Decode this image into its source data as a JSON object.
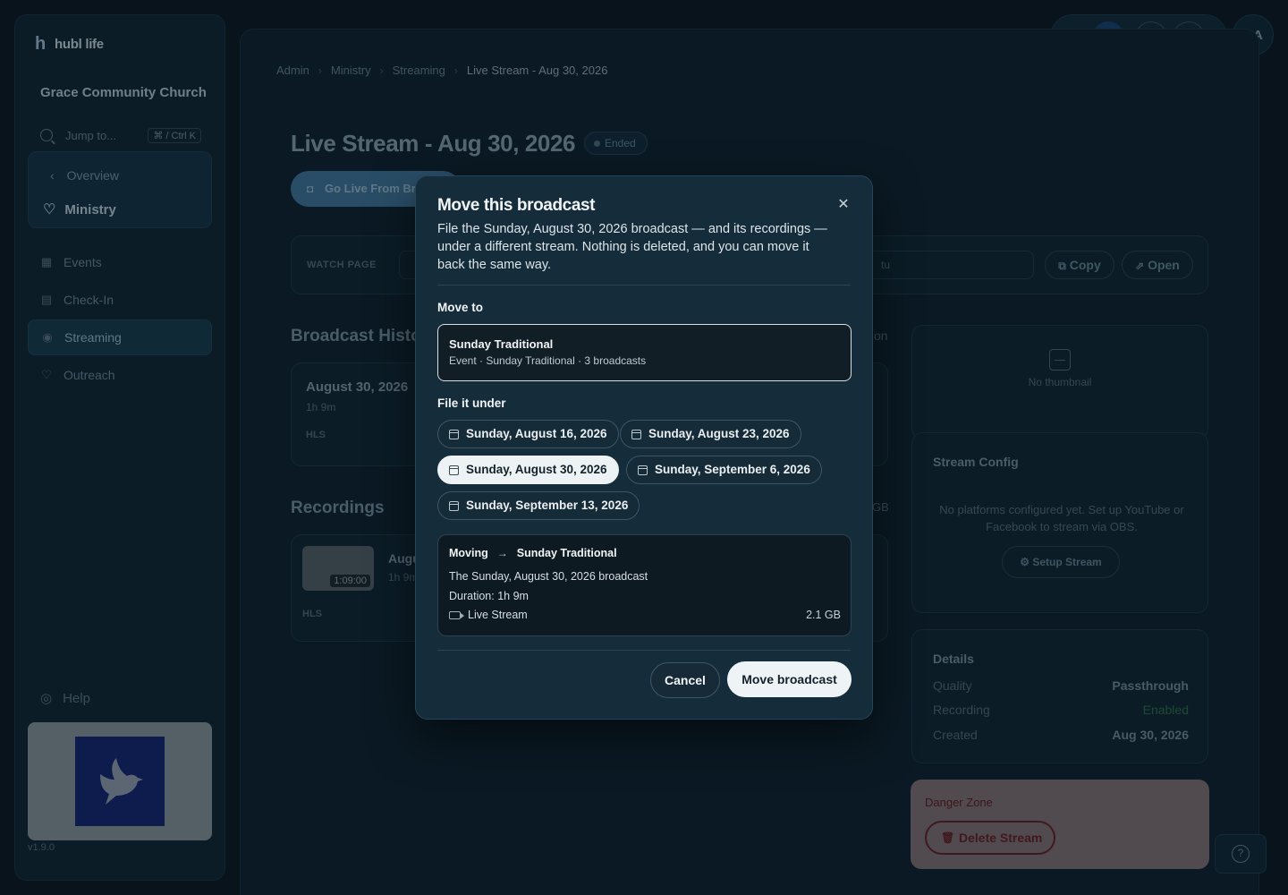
{
  "app": {
    "brand": "hubl life",
    "org_name": "Grace Community Church",
    "jump_placeholder": "Jump to...",
    "jump_shortcut": "⌘ / Ctrl K",
    "version": "v1.9.0"
  },
  "sidebar": {
    "overview_label": "Overview",
    "ministry_label": "Ministry",
    "items": [
      {
        "label": "Events",
        "icon": "calendar-icon"
      },
      {
        "label": "Check-In",
        "icon": "clipboard-icon"
      },
      {
        "label": "Streaming",
        "icon": "broadcast-icon",
        "active": true
      },
      {
        "label": "Outreach",
        "icon": "heart-icon"
      }
    ],
    "help_label": "Help"
  },
  "topbar": {
    "avatar_initials": "AA"
  },
  "breadcrumb": [
    "Admin",
    "Ministry",
    "Streaming",
    "Live Stream - Aug 30, 2026"
  ],
  "page": {
    "title": "Live Stream - Aug 30, 2026",
    "status": "Ended",
    "go_live_label": "Go Live From Br",
    "watch_label": "WATCH PAGE",
    "watch_url_fragment": "tu",
    "copy_label": "Copy",
    "open_label": "Open",
    "history_title": "Broadcast Histo",
    "history_card": {
      "date": "August 30, 2026",
      "duration": "1h 9m",
      "format": "HLS"
    },
    "recordings_title": "Recordings",
    "recording": {
      "time": "1:09:00",
      "title_fragment": "Augu",
      "duration_fragment": "1h 9m",
      "format": "HLS",
      "size_fragment": "GB"
    },
    "right_fragment": "on"
  },
  "thumbnail": {
    "empty_text": "No thumbnail"
  },
  "stream_config": {
    "title": "Stream Config",
    "text": "No platforms configured yet. Set up YouTube or Facebook to stream via OBS.",
    "setup_label": "Setup Stream"
  },
  "details": {
    "title": "Details",
    "rows": [
      {
        "key": "Quality",
        "value": "Passthrough"
      },
      {
        "key": "Recording",
        "value": "Enabled"
      },
      {
        "key": "Created",
        "value": "Aug 30, 2026"
      }
    ]
  },
  "danger": {
    "title": "Danger Zone",
    "delete_label": "Delete Stream"
  },
  "modal": {
    "title": "Move this broadcast",
    "description": "File the Sunday, August 30, 2026 broadcast — and its recordings — under a different stream. Nothing is deleted, and you can move it back the same way.",
    "move_to_label": "Move to",
    "selected_stream": {
      "name": "Sunday Traditional",
      "meta": "Event · Sunday Traditional · 3 broadcasts"
    },
    "file_under_label": "File it under",
    "dates": [
      {
        "label": "Sunday, August 16, 2026",
        "selected": false
      },
      {
        "label": "Sunday, August 23, 2026",
        "selected": false
      },
      {
        "label": "Sunday, August 30, 2026",
        "selected": true
      },
      {
        "label": "Sunday, September 6, 2026",
        "selected": false
      },
      {
        "label": "Sunday, September 13, 2026",
        "selected": false
      }
    ],
    "summary": {
      "moving_label": "Moving",
      "target": "Sunday Traditional",
      "broadcast_line": "The Sunday, August 30, 2026 broadcast",
      "duration_line": "Duration: 1h 9m",
      "file_name": "Live Stream",
      "file_size": "2.1 GB"
    },
    "cancel_label": "Cancel",
    "confirm_label": "Move broadcast"
  }
}
